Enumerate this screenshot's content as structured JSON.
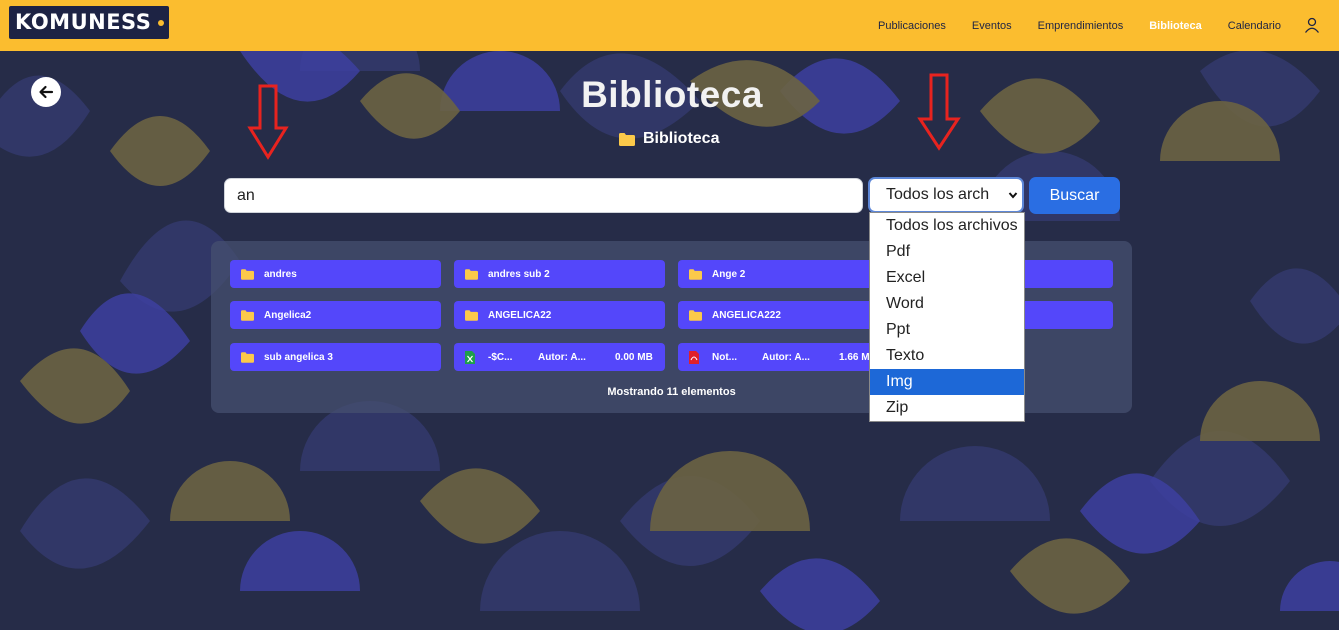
{
  "navbar": {
    "logo_text": "KOMUNESS",
    "links": [
      "Publicaciones",
      "Eventos",
      "Emprendimientos",
      "Biblioteca",
      "Calendario"
    ],
    "active_link": "Biblioteca",
    "user_icon": "user-icon"
  },
  "page": {
    "title": "Biblioteca",
    "breadcrumb": "Biblioteca"
  },
  "search": {
    "value": "an",
    "filter_selected": "Todos los arch",
    "button_label": "Buscar"
  },
  "dropdown": {
    "options": [
      "Todos los archivos",
      "Pdf",
      "Excel",
      "Word",
      "Ppt",
      "Texto",
      "Img",
      "Zip"
    ],
    "highlighted": "Img"
  },
  "results": {
    "items": [
      {
        "type": "folder",
        "name": "andres"
      },
      {
        "type": "folder",
        "name": "andres sub 2"
      },
      {
        "type": "folder",
        "name": "Ange 2"
      },
      {
        "type": "folder",
        "name": "Angelica2"
      },
      {
        "type": "folder",
        "name": "ANGELICA22"
      },
      {
        "type": "folder",
        "name": "ANGELICA222"
      },
      {
        "type": "folder",
        "name": "sub angelica 3"
      },
      {
        "type": "excel",
        "name": "-$C...",
        "author": "Autor: A...",
        "size": "0.00 MB"
      },
      {
        "type": "pdf",
        "name": "Not...",
        "author": "Autor: A...",
        "size": "1.66 M"
      }
    ],
    "status": "Mostrando 11 elementos"
  },
  "colors": {
    "navbar": "#fbbd2f",
    "item": "#5447fa",
    "button": "#2a6ee3",
    "highlight": "#1d68d7",
    "arrow": "#e8231f"
  }
}
